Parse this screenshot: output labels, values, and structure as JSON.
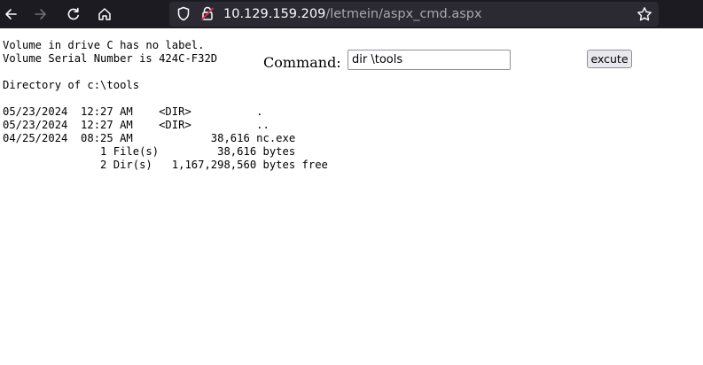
{
  "browser": {
    "url_host": "10.129.159.209",
    "url_path": "/letmein/aspx_cmd.aspx",
    "icons": [
      "back-icon",
      "forward-icon",
      "reload-icon",
      "home-icon",
      "shield-icon",
      "lock-icon",
      "bookmark-star-icon"
    ]
  },
  "page": {
    "command_label": "Command:",
    "command_value": "dir \\tools",
    "execute_label": "excute",
    "output": "Volume in drive C has no label.\nVolume Serial Number is 424C-F32D\n\nDirectory of c:\\tools\n\n05/23/2024  12:27 AM    <DIR>          .\n05/23/2024  12:27 AM    <DIR>          ..\n04/25/2024  08:25 AM            38,616 nc.exe\n               1 File(s)         38,616 bytes\n               2 Dir(s)   1,167,298,560 bytes free"
  }
}
